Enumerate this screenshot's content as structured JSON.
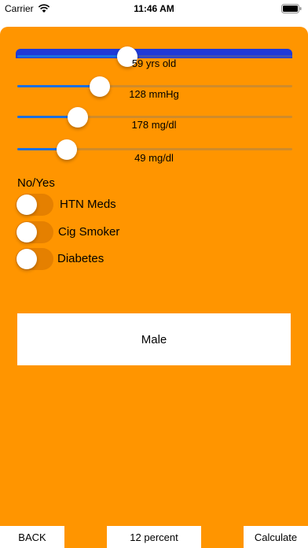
{
  "status_bar": {
    "carrier": "Carrier",
    "time": "11:46 AM"
  },
  "colors": {
    "background": "#ff9500",
    "accent": "#1b6fe0",
    "top_bar": "#1f3ad8"
  },
  "sliders": [
    {
      "name": "age",
      "value_label": "59 yrs old",
      "level": 0.4
    },
    {
      "name": "systolic-bp",
      "value_label": "128 mmHg",
      "level": 0.3
    },
    {
      "name": "total-cholesterol",
      "value_label": "178 mg/dl",
      "level": 0.22
    },
    {
      "name": "hdl-cholesterol",
      "value_label": "49 mg/dl",
      "level": 0.18
    }
  ],
  "toggles_header": "No/Yes",
  "toggles": [
    {
      "label": "HTN Meds",
      "on": false
    },
    {
      "label": "Cig Smoker",
      "on": false
    },
    {
      "label": "Diabetes",
      "on": false
    }
  ],
  "sex_button_label": "Male",
  "bottom_bar": {
    "back_label": "BACK",
    "result_label": "12 percent",
    "calculate_label": "Calculate"
  }
}
